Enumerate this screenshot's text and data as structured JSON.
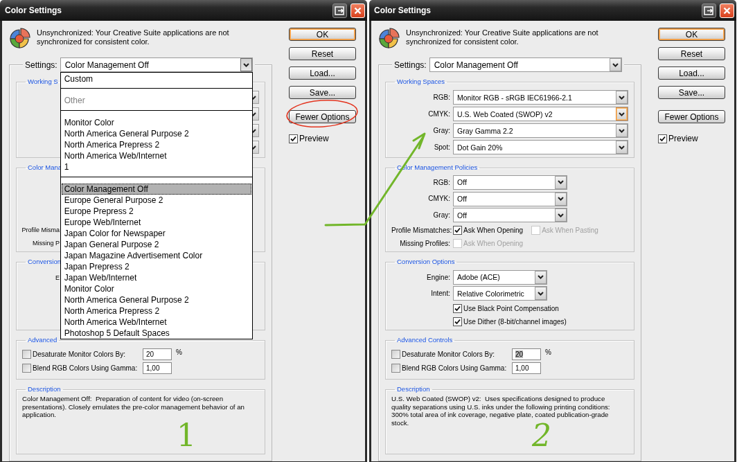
{
  "dialogs": [
    {
      "title": "Color Settings",
      "message": "Unsynchronized: Your Creative Suite applications are not synchronized for consistent color.",
      "settings": {
        "label": "Settings:",
        "value": "Color Management Off",
        "expanded": true
      },
      "dropdown": [
        {
          "items": [
            {
              "label": "Custom",
              "selected": false,
              "disabled": false
            }
          ]
        },
        {
          "items": [
            {
              "label": "Other",
              "selected": false,
              "disabled": true
            }
          ]
        },
        {
          "items": [
            {
              "label": "Monitor Color",
              "selected": false,
              "disabled": false
            },
            {
              "label": "North America General Purpose 2",
              "selected": false,
              "disabled": false
            },
            {
              "label": "North America Prepress 2",
              "selected": false,
              "disabled": false
            },
            {
              "label": "North America Web/Internet",
              "selected": false,
              "disabled": false
            },
            {
              "label": "1",
              "selected": false,
              "disabled": false
            }
          ]
        },
        {
          "items": [
            {
              "label": "Color Management Off",
              "selected": true,
              "disabled": false
            },
            {
              "label": "Europe General Purpose 2",
              "selected": false,
              "disabled": false
            },
            {
              "label": "Europe Prepress 2",
              "selected": false,
              "disabled": false
            },
            {
              "label": "Europe Web/Internet",
              "selected": false,
              "disabled": false
            },
            {
              "label": "Japan Color for Newspaper",
              "selected": false,
              "disabled": false
            },
            {
              "label": "Japan General Purpose 2",
              "selected": false,
              "disabled": false
            },
            {
              "label": "Japan Magazine Advertisement Color",
              "selected": false,
              "disabled": false
            },
            {
              "label": "Japan Prepress 2",
              "selected": false,
              "disabled": false
            },
            {
              "label": "Japan Web/Internet",
              "selected": false,
              "disabled": false
            },
            {
              "label": "Monitor Color",
              "selected": false,
              "disabled": false
            },
            {
              "label": "North America General Purpose 2",
              "selected": false,
              "disabled": false
            },
            {
              "label": "North America Prepress 2",
              "selected": false,
              "disabled": false
            },
            {
              "label": "North America Web/Internet",
              "selected": false,
              "disabled": false
            },
            {
              "label": "Photoshop 5 Default Spaces",
              "selected": false,
              "disabled": false
            }
          ]
        }
      ],
      "sections": [
        {
          "kind": "working-spaces",
          "title": "Working S",
          "rows": [
            {
              "kind": "select-stub"
            },
            {
              "kind": "select-stub"
            },
            {
              "kind": "select-stub"
            },
            {
              "kind": "select-stub"
            }
          ]
        },
        {
          "kind": "policies",
          "title": "Color Mana",
          "rows": [
            {
              "kind": "cut-label",
              "label": "Profile Misma"
            },
            {
              "kind": "cut-label",
              "label": "Missing P"
            }
          ]
        },
        {
          "kind": "conversion",
          "title": "Conversion",
          "rows": [
            {
              "kind": "cut-label",
              "label": "E"
            }
          ]
        },
        {
          "kind": "advanced",
          "title": "Advanced",
          "rows": [
            {
              "kind": "check-input",
              "label": "Desaturate Monitor Colors By:",
              "checked": false,
              "value": "20",
              "value_selected": false,
              "suffix": "%"
            },
            {
              "kind": "check-input",
              "label": "Blend RGB Colors Using Gamma:",
              "checked": false,
              "value": "1,00",
              "value_selected": false
            }
          ]
        }
      ],
      "description": {
        "title": "Description",
        "text": "Color Management Off:  Preparation of content for video (on-screen presentations). Closely emulates the pre-color management behavior of an application."
      },
      "buttons": [
        {
          "label": "OK",
          "default": true
        },
        {
          "label": "Reset",
          "default": false
        },
        {
          "label": "Load...",
          "default": false
        },
        {
          "label": "Save...",
          "default": false
        },
        {
          "label": "Fewer Options",
          "default": false
        }
      ],
      "preview": {
        "label": "Preview",
        "checked": true
      }
    },
    {
      "title": "Color Settings",
      "message": "Unsynchronized: Your Creative Suite applications are not synchronized for consistent color.",
      "settings": {
        "label": "Settings:",
        "value": "Color Management Off",
        "expanded": false
      },
      "sections": [
        {
          "kind": "working-spaces",
          "title": "Working Spaces",
          "rows": [
            {
              "kind": "select",
              "label": "RGB:",
              "value": "Monitor RGB - sRGB IEC61966-2.1",
              "focused": false
            },
            {
              "kind": "select",
              "label": "CMYK:",
              "value": "U.S. Web Coated (SWOP) v2",
              "focused": true
            },
            {
              "kind": "select",
              "label": "Gray:",
              "value": "Gray Gamma 2.2",
              "focused": false
            },
            {
              "kind": "select",
              "label": "Spot:",
              "value": "Dot Gain 20%",
              "focused": false
            }
          ]
        },
        {
          "kind": "policies",
          "title": "Color Management Policies",
          "rows": [
            {
              "kind": "select",
              "label": "RGB:",
              "value": "Off",
              "focused": false
            },
            {
              "kind": "select",
              "label": "CMYK:",
              "value": "Off",
              "focused": false
            },
            {
              "kind": "select",
              "label": "Gray:",
              "value": "Off",
              "focused": false
            },
            {
              "kind": "checks",
              "label": "Profile Mismatches:",
              "checks": [
                {
                  "label": "Ask When Opening",
                  "checked": true,
                  "disabled": false
                },
                {
                  "label": "Ask When Pasting",
                  "checked": false,
                  "disabled": true
                }
              ]
            },
            {
              "kind": "checks",
              "label": "Missing Profiles:",
              "checks": [
                {
                  "label": "Ask When Opening",
                  "checked": false,
                  "disabled": true
                }
              ]
            }
          ]
        },
        {
          "kind": "conversion",
          "title": "Conversion Options",
          "rows": [
            {
              "kind": "select",
              "label": "Engine:",
              "value": "Adobe (ACE)",
              "focused": false
            },
            {
              "kind": "select",
              "label": "Intent:",
              "value": "Relative Colorimetric",
              "focused": false
            },
            {
              "kind": "checks",
              "checks": [
                {
                  "label": "Use Black Point Compensation",
                  "checked": true,
                  "disabled": false
                }
              ]
            },
            {
              "kind": "checks",
              "checks": [
                {
                  "label": "Use Dither (8-bit/channel images)",
                  "checked": true,
                  "disabled": false
                }
              ]
            }
          ]
        },
        {
          "kind": "advanced",
          "title": "Advanced Controls",
          "rows": [
            {
              "kind": "check-input",
              "label": "Desaturate Monitor Colors By:",
              "checked": false,
              "value": "20",
              "value_selected": true,
              "suffix": "%"
            },
            {
              "kind": "check-input",
              "label": "Blend RGB Colors Using Gamma:",
              "checked": false,
              "value": "1,00",
              "value_selected": false
            }
          ]
        }
      ],
      "description": {
        "title": "Description",
        "text": "U.S. Web Coated (SWOP) v2:  Uses specifications designed to produce quality separations using U.S. inks under the following printing conditions: 300% total area of ink coverage, negative plate, coated publication-grade stock."
      },
      "buttons": [
        {
          "label": "OK",
          "default": true
        },
        {
          "label": "Reset",
          "default": false
        },
        {
          "label": "Load...",
          "default": false
        },
        {
          "label": "Save...",
          "default": false
        },
        {
          "label": "Fewer Options",
          "default": false
        }
      ],
      "preview": {
        "label": "Preview",
        "checked": true
      }
    }
  ],
  "annotations": [
    {
      "kind": "circle",
      "color": "#e3341f"
    },
    {
      "kind": "arrow",
      "color": "#72b62a"
    },
    {
      "kind": "number",
      "text": "1",
      "color": "#72b62a"
    },
    {
      "kind": "number",
      "text": "2",
      "color": "#72b62a"
    }
  ]
}
